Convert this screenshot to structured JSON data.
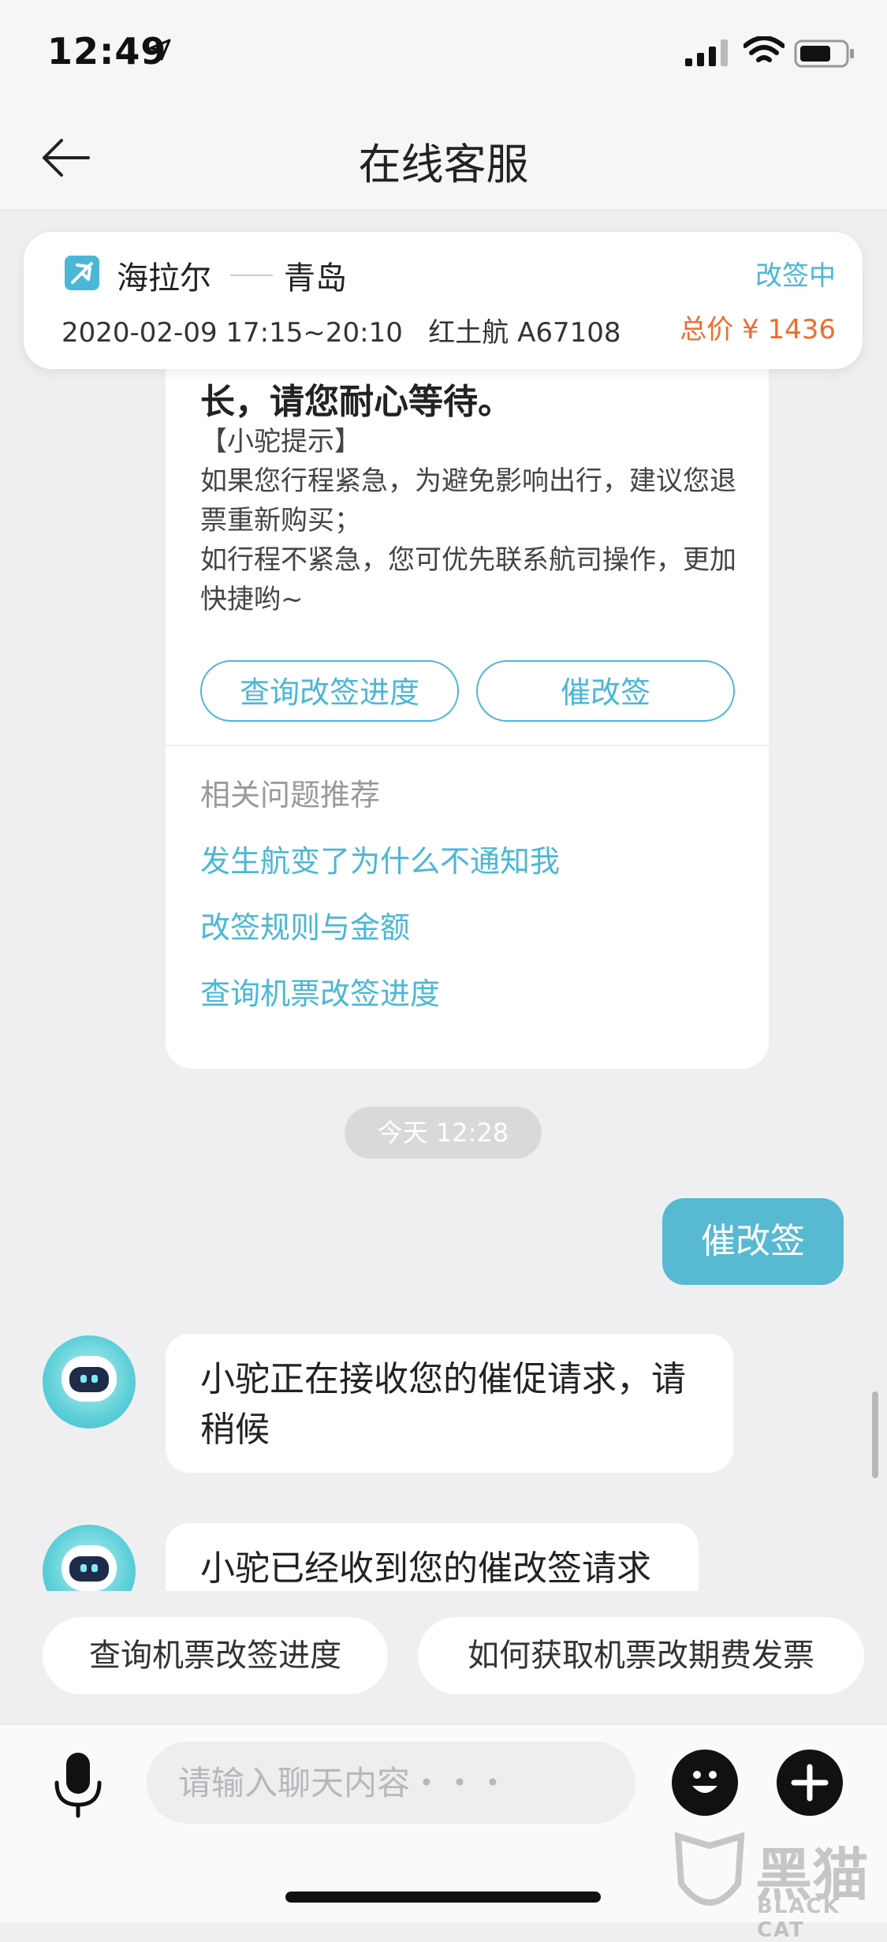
{
  "status_bar": {
    "time": "12:49"
  },
  "nav": {
    "title": "在线客服"
  },
  "flight": {
    "from": "海拉尔",
    "to": "青岛",
    "info": "2020-02-09 17:15~20:10   红土航 A67108",
    "status": "改签中",
    "price": "总价 ¥ 1436"
  },
  "bot_card": {
    "cut_text": "长，请您耐心等待。",
    "tip": "【小驼提示】\n如果您行程紧急，为避免影响出行，建议您退票重新购买；\n如行程不紧急，您可优先联系航司操作，更加快捷哟~",
    "buttons": [
      "查询改签进度",
      "催改签"
    ],
    "related_title": "相关问题推荐",
    "related": [
      "发生航变了为什么不通知我",
      "改签规则与金额",
      "查询机票改签进度"
    ]
  },
  "chat": {
    "timestamp": "今天 12:28",
    "user_message": "催改签",
    "bot_message_1": "小驼正在接收您的催促请求，请稍候",
    "bot_message_2": "小驼已经收到您的催改签请求"
  },
  "quick_replies": [
    "查询机票改签进度",
    "如何获取机票改期费发票"
  ],
  "input": {
    "placeholder": "请输入聊天内容・・・"
  },
  "watermark": {
    "cn": "黑猫",
    "en": "BLACK CAT"
  },
  "colors": {
    "accent": "#4bb7d6",
    "price": "#ec6e2e",
    "user_bubble": "#58b9d3",
    "background": "#efeff1"
  }
}
